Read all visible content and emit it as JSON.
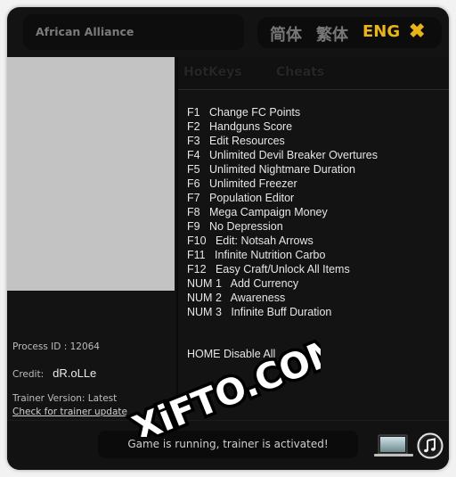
{
  "window": {
    "title": "African Alliance",
    "languages": [
      {
        "label": "简体",
        "active": false
      },
      {
        "label": "繁体",
        "active": false
      },
      {
        "label": "ENG",
        "active": true
      }
    ],
    "close_icon": "close-x-icon",
    "accent_color": "#e8b418"
  },
  "tabs": [
    {
      "label": "HotKeys"
    },
    {
      "label": "Cheats"
    }
  ],
  "hotkeys": [
    {
      "key": "F1",
      "action": "Change FC Points"
    },
    {
      "key": "F2",
      "action": "Handguns Score"
    },
    {
      "key": "F3",
      "action": "Edit Resources"
    },
    {
      "key": "F4",
      "action": "Unlimited Devil Breaker Overtures"
    },
    {
      "key": "F5",
      "action": "Unlimited Nightmare Duration"
    },
    {
      "key": "F6",
      "action": "Unlimited Freezer"
    },
    {
      "key": "F7",
      "action": "Population Editor"
    },
    {
      "key": "F8",
      "action": "Mega Campaign Money"
    },
    {
      "key": "F9",
      "action": "No Depression"
    },
    {
      "key": "F10",
      "action": "Edit: Notsah Arrows"
    },
    {
      "key": "F11",
      "action": "Infinite Nutrition Carbo"
    },
    {
      "key": "F12",
      "action": "Easy Craft/Unlock All Items"
    },
    {
      "key": "NUM 1",
      "action": "Add Currency"
    },
    {
      "key": "NUM 2",
      "action": "Awareness"
    },
    {
      "key": "NUM 3",
      "action": "Infinite Buff Duration"
    }
  ],
  "home_line": "HOME Disable All",
  "info": {
    "process_label": "Process ID : ",
    "process_id": "12064",
    "credit_label": "Credit:",
    "credit_value": "dR.oLLe",
    "version_label": "Trainer Version: ",
    "version_value": "Latest",
    "update_link": "Check for trainer update"
  },
  "status": {
    "text": "Game is running, trainer is activated!"
  },
  "icons": {
    "laptop": "laptop-icon",
    "music": "music-icon"
  },
  "watermark": {
    "text": "XiFTO.COM"
  }
}
